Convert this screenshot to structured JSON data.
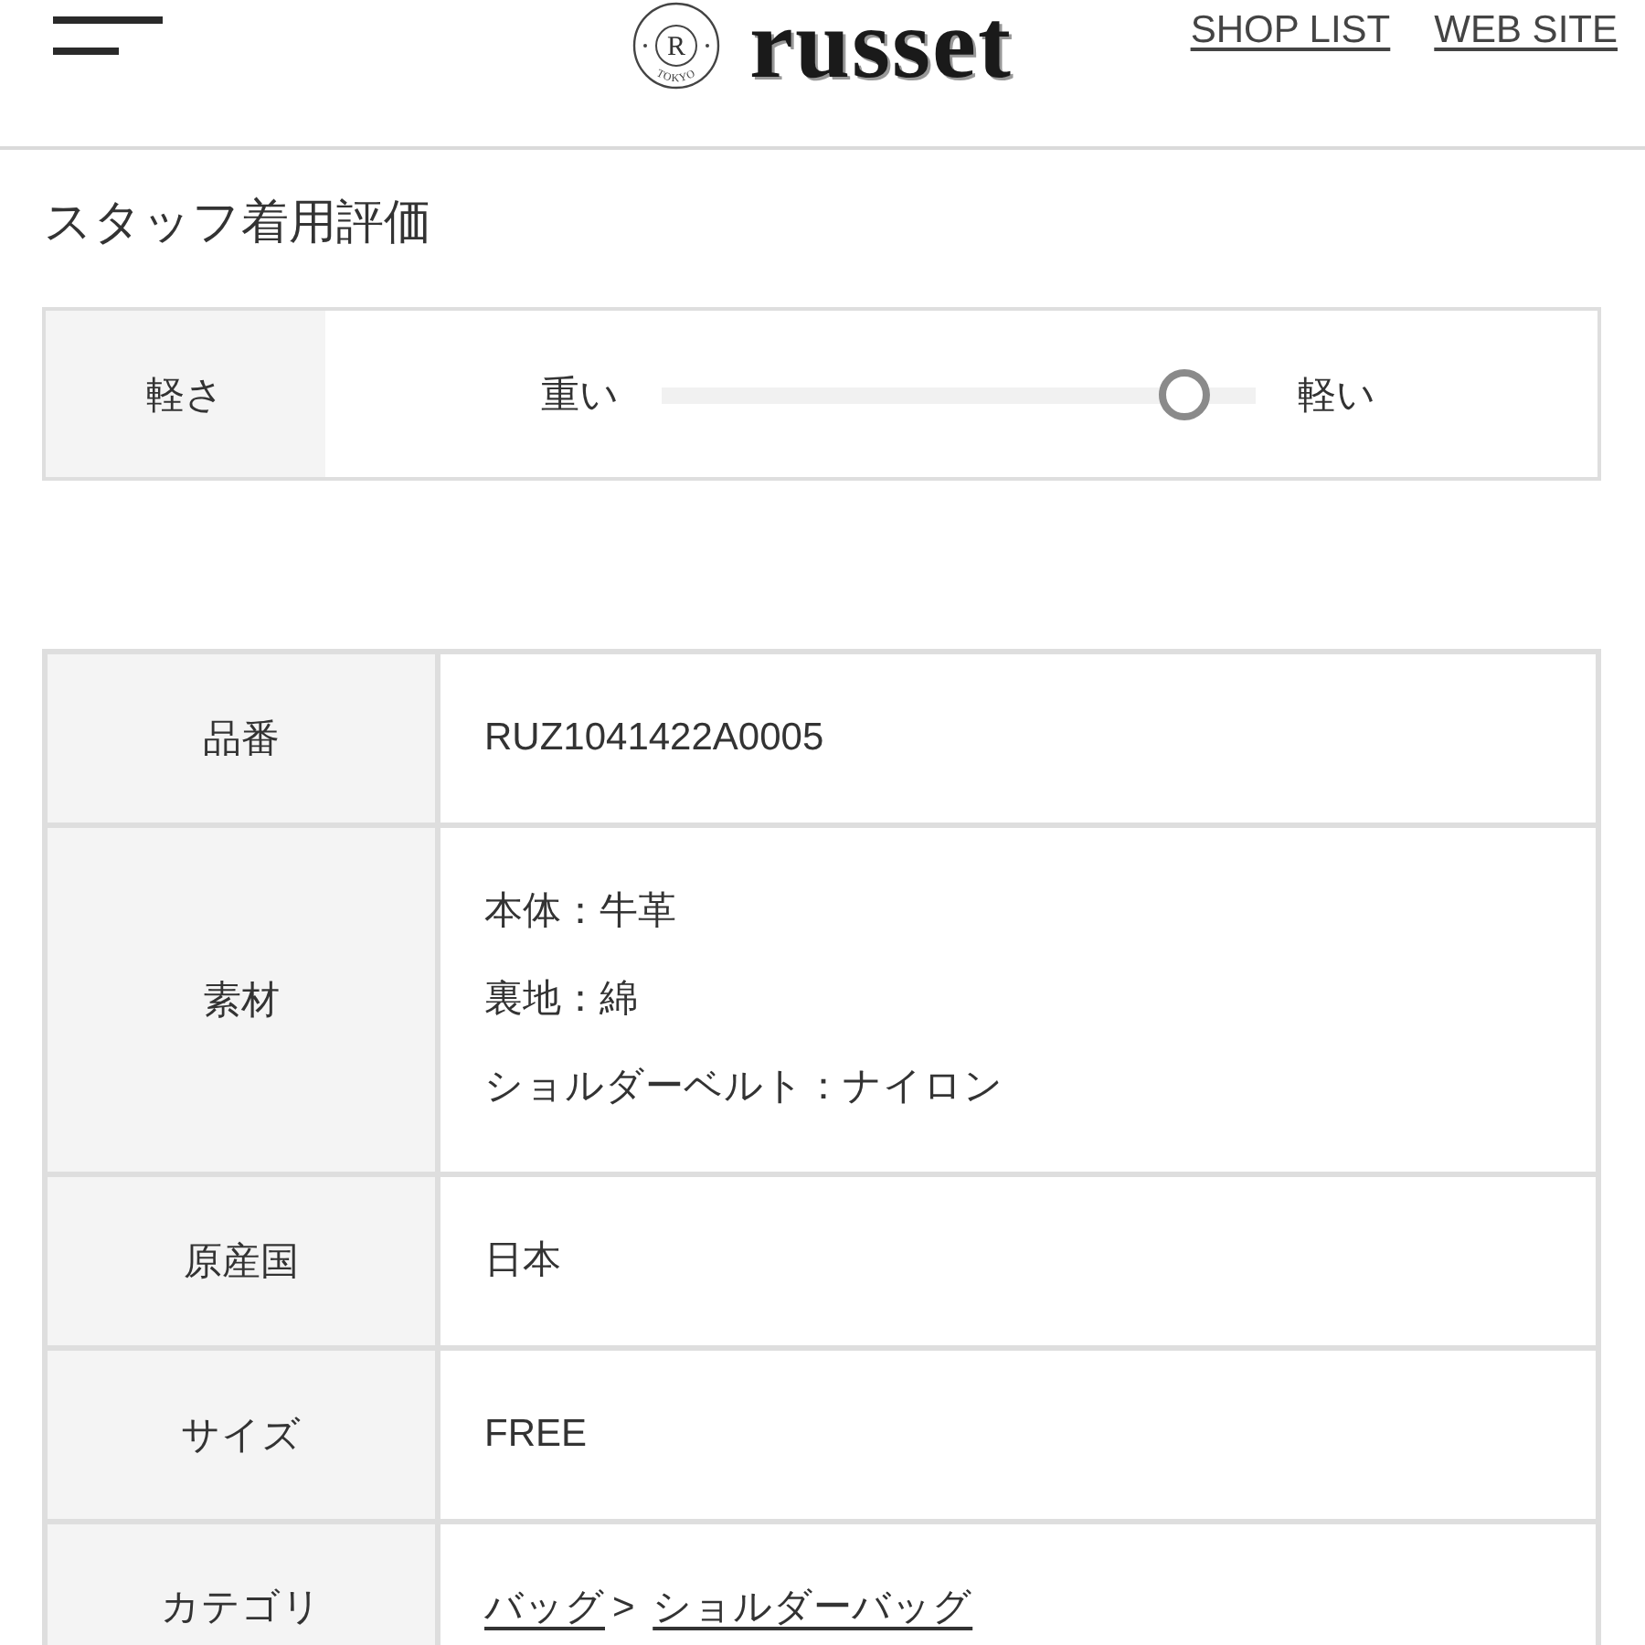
{
  "header": {
    "logo": {
      "mark": "R",
      "ring_text": "TOKYO",
      "wordmark": "russet"
    },
    "links": [
      "SHOP LIST",
      "WEB SITE"
    ]
  },
  "staff_rating": {
    "title": "スタッフ着用評価",
    "items": [
      {
        "label": "軽さ",
        "min_label": "重い",
        "max_label": "軽い",
        "level": 0.88
      }
    ]
  },
  "spec_table": {
    "rows": [
      {
        "label": "品番",
        "kind": "text",
        "values": [
          "RUZ1041422A0005"
        ]
      },
      {
        "label": "素材",
        "kind": "text",
        "values": [
          "本体：牛革",
          "裏地：綿",
          "ショルダーベルト：ナイロン"
        ]
      },
      {
        "label": "原産国",
        "kind": "text",
        "values": [
          "日本"
        ]
      },
      {
        "label": "サイズ",
        "kind": "text",
        "values": [
          "FREE"
        ]
      },
      {
        "label": "カテゴリ",
        "kind": "breadcrumb",
        "links": [
          "バッグ",
          "ショルダーバッグ"
        ],
        "separator": ">"
      }
    ]
  }
}
